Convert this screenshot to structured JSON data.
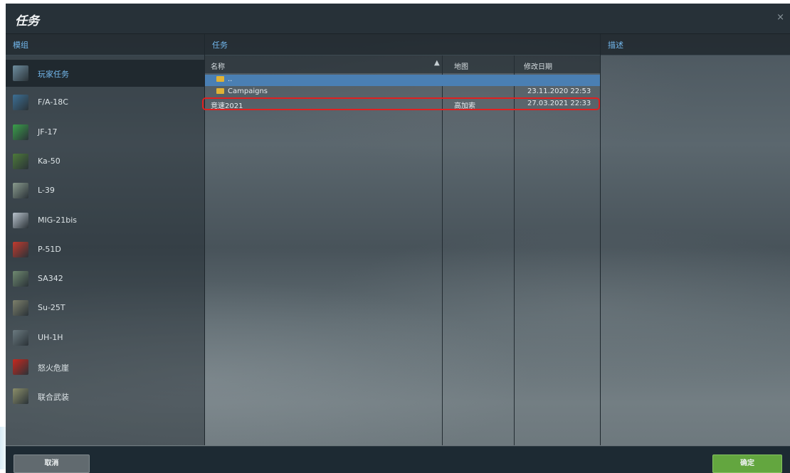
{
  "window": {
    "title": "任务",
    "close_glyph": "×"
  },
  "columns": {
    "left": "模组",
    "middle": "任务",
    "right": "描述"
  },
  "sidebar": {
    "items": [
      {
        "label": "玩家任务",
        "icon": "player-mission-icon",
        "color": "#6e8ea0",
        "selected": true
      },
      {
        "label": "F/A-18C",
        "icon": "fa18c-icon",
        "color": "#3c6f95"
      },
      {
        "label": "JF-17",
        "icon": "jf17-icon",
        "color": "#3aa04a"
      },
      {
        "label": "Ka-50",
        "icon": "ka50-icon",
        "color": "#4d7a3a"
      },
      {
        "label": "L-39",
        "icon": "l39-icon",
        "color": "#8a9b8e"
      },
      {
        "label": "MIG-21bis",
        "icon": "mig21bis-icon",
        "color": "#b8c2cc"
      },
      {
        "label": "P-51D",
        "icon": "p51d-icon",
        "color": "#c23a2e"
      },
      {
        "label": "SA342",
        "icon": "sa342-icon",
        "color": "#6f8a70"
      },
      {
        "label": "Su-25T",
        "icon": "su25t-icon",
        "color": "#7d806b"
      },
      {
        "label": "UH-1H",
        "icon": "uh1h-icon",
        "color": "#6b7a80"
      },
      {
        "label": "怒火危崖",
        "icon": "star-icon",
        "color": "#c8281e"
      },
      {
        "label": "联合武装",
        "icon": "combined-arms-icon",
        "color": "#8c8f6a"
      }
    ]
  },
  "table": {
    "headers": {
      "name": "名称",
      "map": "地图",
      "date": "修改日期"
    },
    "sort_indicator": "▲",
    "rows": [
      {
        "type": "folder",
        "name": "..",
        "map": "",
        "date": "",
        "selected": true
      },
      {
        "type": "folder",
        "name": "Campaigns",
        "map": "",
        "date": "23.11.2020 22:53"
      },
      {
        "type": "file",
        "name": "竞速2021",
        "map": "高加索",
        "date": "27.03.2021 22:33",
        "highlighted": true
      }
    ]
  },
  "footer": {
    "cancel_label": "取消",
    "ok_label": "确定"
  },
  "colors": {
    "accent": "#73b8ed",
    "ok_button": "#63a63f",
    "selection": "#4a7fb3",
    "highlight_box": "#e02020"
  }
}
